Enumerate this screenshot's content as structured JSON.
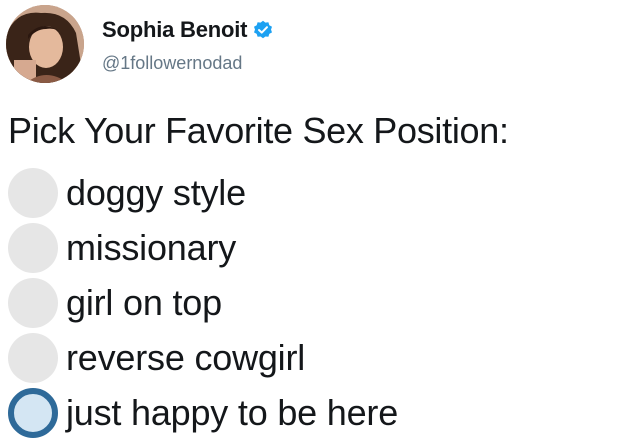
{
  "author": {
    "name": "Sophia Benoit",
    "handle": "@1followernodad",
    "verified": true,
    "avatar_icon": "profile-photo"
  },
  "poll": {
    "title": "Pick Your Favorite Sex Position:",
    "options": [
      {
        "label": "doggy style",
        "selected": false
      },
      {
        "label": "missionary",
        "selected": false
      },
      {
        "label": "girl on top",
        "selected": false
      },
      {
        "label": "reverse cowgirl",
        "selected": false
      },
      {
        "label": "just happy to be here",
        "selected": true
      }
    ]
  },
  "colors": {
    "text": "#14171a",
    "handle": "#657786",
    "verified_badge": "#1da1f2",
    "radio_unselected": "#e6e6e6",
    "radio_selected_ring": "#2e6a99",
    "radio_selected_fill": "#d4e6f3"
  }
}
